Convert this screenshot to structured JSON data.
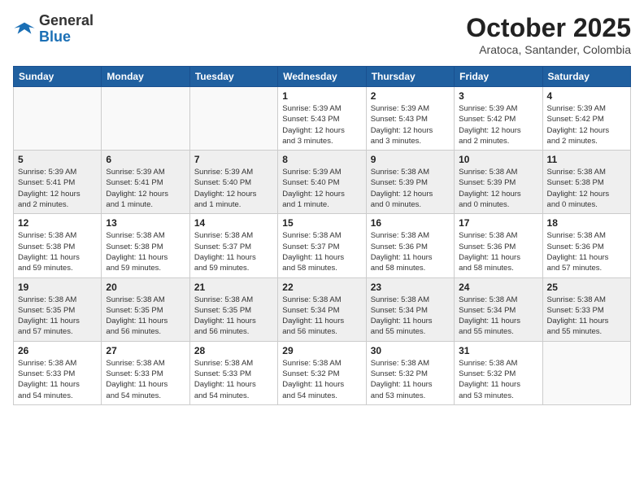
{
  "header": {
    "logo_general": "General",
    "logo_blue": "Blue",
    "month_title": "October 2025",
    "location": "Aratoca, Santander, Colombia"
  },
  "days_of_week": [
    "Sunday",
    "Monday",
    "Tuesday",
    "Wednesday",
    "Thursday",
    "Friday",
    "Saturday"
  ],
  "weeks": [
    [
      {
        "day": "",
        "info": ""
      },
      {
        "day": "",
        "info": ""
      },
      {
        "day": "",
        "info": ""
      },
      {
        "day": "1",
        "info": "Sunrise: 5:39 AM\nSunset: 5:43 PM\nDaylight: 12 hours\nand 3 minutes."
      },
      {
        "day": "2",
        "info": "Sunrise: 5:39 AM\nSunset: 5:43 PM\nDaylight: 12 hours\nand 3 minutes."
      },
      {
        "day": "3",
        "info": "Sunrise: 5:39 AM\nSunset: 5:42 PM\nDaylight: 12 hours\nand 2 minutes."
      },
      {
        "day": "4",
        "info": "Sunrise: 5:39 AM\nSunset: 5:42 PM\nDaylight: 12 hours\nand 2 minutes."
      }
    ],
    [
      {
        "day": "5",
        "info": "Sunrise: 5:39 AM\nSunset: 5:41 PM\nDaylight: 12 hours\nand 2 minutes."
      },
      {
        "day": "6",
        "info": "Sunrise: 5:39 AM\nSunset: 5:41 PM\nDaylight: 12 hours\nand 1 minute."
      },
      {
        "day": "7",
        "info": "Sunrise: 5:39 AM\nSunset: 5:40 PM\nDaylight: 12 hours\nand 1 minute."
      },
      {
        "day": "8",
        "info": "Sunrise: 5:39 AM\nSunset: 5:40 PM\nDaylight: 12 hours\nand 1 minute."
      },
      {
        "day": "9",
        "info": "Sunrise: 5:38 AM\nSunset: 5:39 PM\nDaylight: 12 hours\nand 0 minutes."
      },
      {
        "day": "10",
        "info": "Sunrise: 5:38 AM\nSunset: 5:39 PM\nDaylight: 12 hours\nand 0 minutes."
      },
      {
        "day": "11",
        "info": "Sunrise: 5:38 AM\nSunset: 5:38 PM\nDaylight: 12 hours\nand 0 minutes."
      }
    ],
    [
      {
        "day": "12",
        "info": "Sunrise: 5:38 AM\nSunset: 5:38 PM\nDaylight: 11 hours\nand 59 minutes."
      },
      {
        "day": "13",
        "info": "Sunrise: 5:38 AM\nSunset: 5:38 PM\nDaylight: 11 hours\nand 59 minutes."
      },
      {
        "day": "14",
        "info": "Sunrise: 5:38 AM\nSunset: 5:37 PM\nDaylight: 11 hours\nand 59 minutes."
      },
      {
        "day": "15",
        "info": "Sunrise: 5:38 AM\nSunset: 5:37 PM\nDaylight: 11 hours\nand 58 minutes."
      },
      {
        "day": "16",
        "info": "Sunrise: 5:38 AM\nSunset: 5:36 PM\nDaylight: 11 hours\nand 58 minutes."
      },
      {
        "day": "17",
        "info": "Sunrise: 5:38 AM\nSunset: 5:36 PM\nDaylight: 11 hours\nand 58 minutes."
      },
      {
        "day": "18",
        "info": "Sunrise: 5:38 AM\nSunset: 5:36 PM\nDaylight: 11 hours\nand 57 minutes."
      }
    ],
    [
      {
        "day": "19",
        "info": "Sunrise: 5:38 AM\nSunset: 5:35 PM\nDaylight: 11 hours\nand 57 minutes."
      },
      {
        "day": "20",
        "info": "Sunrise: 5:38 AM\nSunset: 5:35 PM\nDaylight: 11 hours\nand 56 minutes."
      },
      {
        "day": "21",
        "info": "Sunrise: 5:38 AM\nSunset: 5:35 PM\nDaylight: 11 hours\nand 56 minutes."
      },
      {
        "day": "22",
        "info": "Sunrise: 5:38 AM\nSunset: 5:34 PM\nDaylight: 11 hours\nand 56 minutes."
      },
      {
        "day": "23",
        "info": "Sunrise: 5:38 AM\nSunset: 5:34 PM\nDaylight: 11 hours\nand 55 minutes."
      },
      {
        "day": "24",
        "info": "Sunrise: 5:38 AM\nSunset: 5:34 PM\nDaylight: 11 hours\nand 55 minutes."
      },
      {
        "day": "25",
        "info": "Sunrise: 5:38 AM\nSunset: 5:33 PM\nDaylight: 11 hours\nand 55 minutes."
      }
    ],
    [
      {
        "day": "26",
        "info": "Sunrise: 5:38 AM\nSunset: 5:33 PM\nDaylight: 11 hours\nand 54 minutes."
      },
      {
        "day": "27",
        "info": "Sunrise: 5:38 AM\nSunset: 5:33 PM\nDaylight: 11 hours\nand 54 minutes."
      },
      {
        "day": "28",
        "info": "Sunrise: 5:38 AM\nSunset: 5:33 PM\nDaylight: 11 hours\nand 54 minutes."
      },
      {
        "day": "29",
        "info": "Sunrise: 5:38 AM\nSunset: 5:32 PM\nDaylight: 11 hours\nand 54 minutes."
      },
      {
        "day": "30",
        "info": "Sunrise: 5:38 AM\nSunset: 5:32 PM\nDaylight: 11 hours\nand 53 minutes."
      },
      {
        "day": "31",
        "info": "Sunrise: 5:38 AM\nSunset: 5:32 PM\nDaylight: 11 hours\nand 53 minutes."
      },
      {
        "day": "",
        "info": ""
      }
    ]
  ]
}
